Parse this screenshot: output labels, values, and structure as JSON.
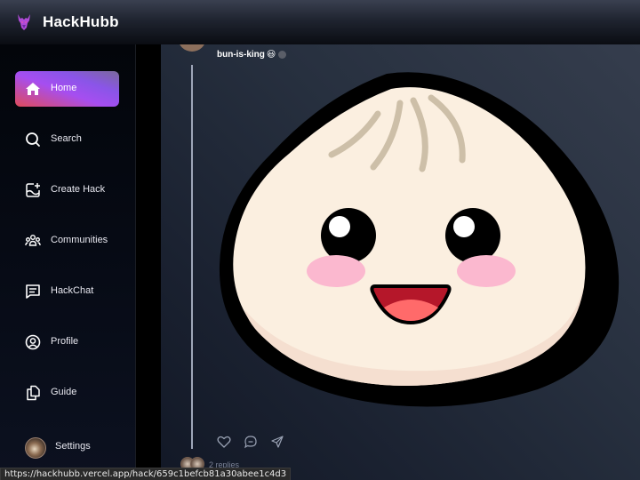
{
  "app": {
    "brand": "HackHubb",
    "logo_icon": "hackhubb-mascot-icon"
  },
  "sidebar": {
    "items": [
      {
        "label": "Home",
        "icon": "home-icon",
        "active": true
      },
      {
        "label": "Search",
        "icon": "search-icon",
        "active": false
      },
      {
        "label": "Create Hack",
        "icon": "create-image-icon",
        "active": false
      },
      {
        "label": "Communities",
        "icon": "communities-icon",
        "active": false
      },
      {
        "label": "HackChat",
        "icon": "chat-icon",
        "active": false
      },
      {
        "label": "Profile",
        "icon": "profile-icon",
        "active": false
      },
      {
        "label": "Guide",
        "icon": "copy-document-icon",
        "active": false
      }
    ],
    "settings": {
      "label": "Settings",
      "icon": "user-avatar"
    }
  },
  "post": {
    "author": "bun-is-king",
    "author_emoji": "😃",
    "image_alt": "Bun mascot",
    "actions": [
      {
        "name": "like",
        "icon": "heart-icon"
      },
      {
        "name": "comment",
        "icon": "comment-icon"
      },
      {
        "name": "share",
        "icon": "send-icon"
      }
    ],
    "replies_label": "2 replies"
  },
  "statusbar": {
    "url": "https://hackhubb.vercel.app/hack/659c1befcb81a30abee1c4d3"
  },
  "colors": {
    "accent_gradient_start": "#e04b5a",
    "accent_gradient_mid": "#a64ef0",
    "main_bg": "#27303f",
    "sidebar_bg": "#060a14"
  }
}
